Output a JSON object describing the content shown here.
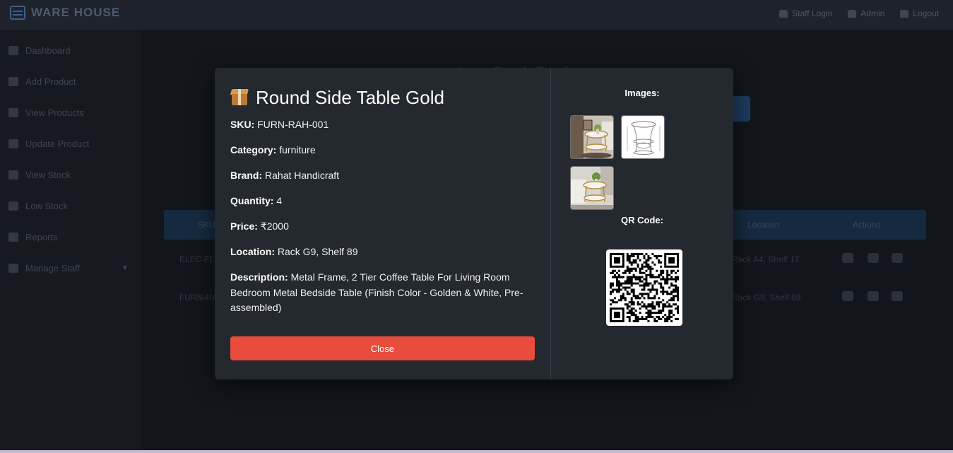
{
  "app": {
    "brand": "WARE HOUSE",
    "nav": [
      "Staff Login",
      "Admin",
      "Logout"
    ]
  },
  "sidebar": {
    "items": [
      {
        "label": "Dashboard"
      },
      {
        "label": "Add Product"
      },
      {
        "label": "View Products"
      },
      {
        "label": "Update Product"
      },
      {
        "label": "View Stock"
      },
      {
        "label": "Low Stock"
      },
      {
        "label": "Reports"
      },
      {
        "label": "Manage Staff"
      }
    ]
  },
  "main": {
    "title": "Low Stock Products",
    "table": {
      "headers": [
        "SKU",
        "Location",
        "Actions"
      ],
      "rows": [
        {
          "sku": "ELEC-FE",
          "location": "Rack A4, Shelf 17"
        },
        {
          "sku": "FURN-RA",
          "location": "Rack G9, Shelf 89"
        }
      ]
    }
  },
  "modal": {
    "title": "Round Side Table Gold",
    "title_icon": "package-icon",
    "fields": [
      {
        "label": "SKU:",
        "value": "FURN-RAH-001"
      },
      {
        "label": "Category:",
        "value": "furniture"
      },
      {
        "label": "Brand:",
        "value": "Rahat Handicraft"
      },
      {
        "label": "Quantity:",
        "value": "4"
      },
      {
        "label": "Price:",
        "value": "₹2000"
      },
      {
        "label": "Location:",
        "value": "Rack G9, Shelf 89"
      },
      {
        "label": "Description:",
        "value": "Metal Frame, 2 Tier Coffee Table For Living Room Bedroom Metal Bedside Table (Finish Color - Golden & White, Pre-assembled)"
      }
    ],
    "close_label": "Close",
    "images_label": "Images:",
    "qr_label": "QR Code:"
  },
  "colors": {
    "modal_bg": "#24282f",
    "close_button": "#e74c3c",
    "page_bg": "#0e1218"
  }
}
